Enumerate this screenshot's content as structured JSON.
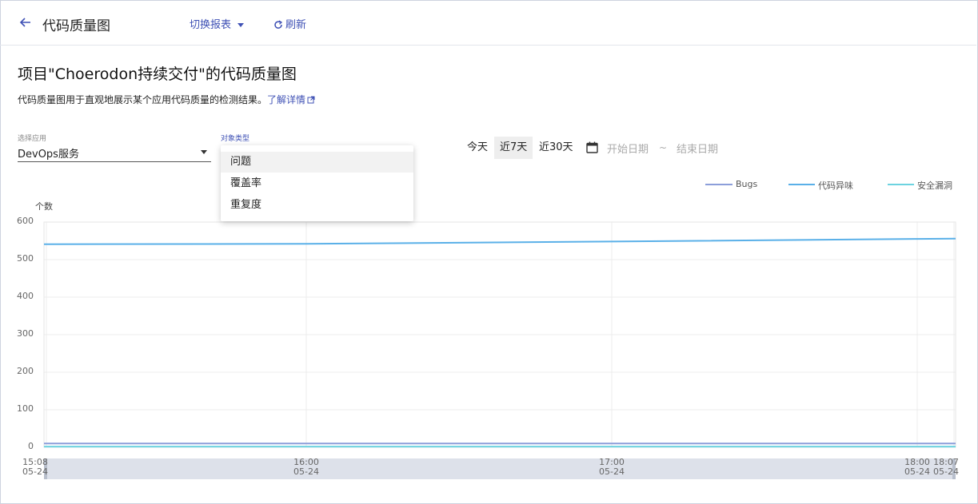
{
  "header": {
    "title": "代码质量图",
    "switch_report": "切换报表",
    "refresh": "刷新"
  },
  "main": {
    "heading": "项目\"Choerodon持续交付\"的代码质量图",
    "description": "代码质量图用于直观地展示某个应用代码质量的检测结果。",
    "learn_more": "了解详情"
  },
  "filters": {
    "app_label": "选择应用",
    "app_value": "DevOps服务",
    "object_type_label": "对象类型",
    "object_type_options": [
      "问题",
      "覆盖率",
      "重复度"
    ],
    "object_type_active": "问题",
    "ranges": [
      "今天",
      "近7天",
      "近30天"
    ],
    "range_selected": "近7天",
    "start_placeholder": "开始日期",
    "end_placeholder": "结束日期",
    "range_separator": "~"
  },
  "colors": {
    "accent": "#3f51b5",
    "bugs": "#8c9eda",
    "code_smell": "#5ab0e8",
    "vulnerability": "#6dd3e0"
  },
  "chart_data": {
    "type": "line",
    "ylabel": "个数",
    "ylim": [
      0,
      600
    ],
    "yticks": [
      "600",
      "500",
      "400",
      "300",
      "200",
      "100",
      "0"
    ],
    "x": [
      "15:08 05-24",
      "16:00 05-24",
      "17:00 05-24",
      "18:00 05-24",
      "18:07 05-24"
    ],
    "x_ticks": [
      {
        "time": "15:08",
        "date": "05-24"
      },
      {
        "time": "16:00",
        "date": "05-24"
      },
      {
        "time": "17:00",
        "date": "05-24"
      },
      {
        "time": "18:00",
        "date": "05-24"
      },
      {
        "time": "18:07",
        "date": "05-24"
      }
    ],
    "series": [
      {
        "name": "Bugs",
        "values": [
          10,
          10,
          10,
          10,
          10
        ]
      },
      {
        "name": "代码异味",
        "values": [
          541,
          542,
          548,
          555,
          556
        ]
      },
      {
        "name": "安全漏洞",
        "values": [
          2,
          2,
          2,
          2,
          2
        ]
      }
    ],
    "legend_position": "top-right",
    "grid": true
  }
}
